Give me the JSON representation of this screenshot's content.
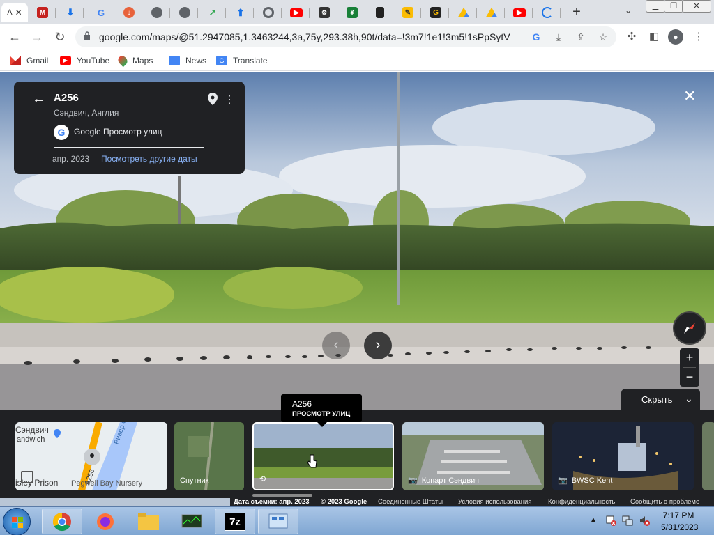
{
  "browser": {
    "tabs": [
      {
        "icon": "google-maps-favicon",
        "letter": "A",
        "active": true
      },
      {
        "icon": "gmail-icon"
      },
      {
        "icon": "download-icon"
      },
      {
        "icon": "google-icon"
      },
      {
        "icon": "download-orange-icon"
      },
      {
        "icon": "globe-icon"
      },
      {
        "icon": "globe-icon"
      },
      {
        "icon": "share-green-icon"
      },
      {
        "icon": "upload-icon"
      },
      {
        "icon": "chrome-icon"
      },
      {
        "icon": "youtube-icon"
      },
      {
        "icon": "plugin-icon"
      },
      {
        "icon": "excel-icon"
      },
      {
        "icon": "document-icon"
      },
      {
        "icon": "pencil-icon"
      },
      {
        "icon": "g-icon"
      },
      {
        "icon": "google-drive-icon"
      },
      {
        "icon": "google-drive-icon"
      },
      {
        "icon": "youtube-icon"
      },
      {
        "icon": "loading-icon"
      }
    ],
    "url": "google.com/maps/@51.2947085,1.3463244,3a,75y,293.38h,90t/data=!3m7!1e1!3m5!1sPpSytViTT...",
    "bookmarks": [
      {
        "label": "Gmail",
        "icon": "gmail-icon"
      },
      {
        "label": "YouTube",
        "icon": "youtube-icon"
      },
      {
        "label": "Maps",
        "icon": "maps-pin-icon"
      },
      {
        "label": "News",
        "icon": "news-icon"
      },
      {
        "label": "Translate",
        "icon": "translate-icon"
      }
    ]
  },
  "street_view": {
    "title": "A256",
    "subtitle": "Сэндвич, Англия",
    "source": "Google Просмотр улиц",
    "date": "апр. 2023",
    "other_dates_link": "Посмотреть другие даты",
    "hide_label": "Скрыть",
    "tooltip_title": "A256",
    "tooltip_sub": "ПРОСМОТР УЛИЦ",
    "thumbnails": [
      {
        "label": "Сэндвич",
        "label2": "andwich",
        "map_label": "Ривер С",
        "road": "A256",
        "place": "Pegwell Bay Nursery",
        "prison": "isley Prison"
      },
      {
        "label": "Спутник"
      },
      {
        "label": ""
      },
      {
        "label": "Копарт Сэндвич"
      },
      {
        "label": "BWSC Kent"
      }
    ],
    "footer": {
      "capture_date": "Дата съемки: апр. 2023",
      "copyright": "© 2023 Google",
      "country": "Соединенные Штаты",
      "terms": "Условия использования",
      "privacy": "Конфиденциальность",
      "report": "Сообщить о проблеме"
    }
  },
  "taskbar": {
    "time": "7:17 PM",
    "date": "5/31/2023"
  }
}
